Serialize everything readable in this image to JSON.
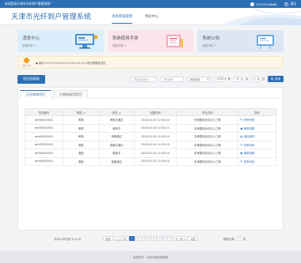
{
  "topbar": {
    "welcome": "欢迎登录天津市光纤到户管理系统！",
    "phone": "15122228888",
    "logout": "退出"
  },
  "header": {
    "title": "天津市光纤到户管理系统",
    "nav": [
      "项目审核管理",
      "帮助中心"
    ]
  },
  "cards": [
    {
      "title": "消息中心",
      "link": "查看详情 ➜"
    },
    {
      "title": "系统使用手册",
      "link": "查看详情 ➜"
    },
    {
      "title": "系统公告",
      "link": "查看详情 ➜"
    }
  ],
  "notice": {
    "label": "最新公告",
    "text": "● 编号1121231415431151421411212项目需要被选定"
  },
  "toolbar": {
    "add_button": "项目档案新",
    "project_name_placeholder": "项目名称查询",
    "project_no_placeholder": "项目编号",
    "status_select": "状态查询",
    "year": "2018",
    "year_label": "年",
    "month": "12",
    "month_label": "月",
    "day": "1",
    "day_label": "日",
    "search_button": "查询"
  },
  "tabs": [
    "正在审核项目",
    "已审核成功项目"
  ],
  "table": {
    "headers": [
      "项目编号",
      "类型",
      "状态",
      "创建时间",
      "项目名称",
      "操作"
    ],
    "rows": [
      {
        "id": "wm00000001",
        "type": "审核",
        "status": "审核未通过",
        "time": "2018.01.04 12:30:14",
        "name": "天津国际综合中心三期",
        "op": "先修代码",
        "op_icon": "edit-icon"
      },
      {
        "id": "wm00000001",
        "type": "审核",
        "status": "审核中",
        "time": "2018.01.04 12:30:14",
        "name": "天津国际综合中心三期",
        "op": "审核查看",
        "op_icon": "view-icon"
      },
      {
        "id": "wm00000001",
        "type": "审核",
        "status": "审核通过",
        "time": "2018.01.04 12:30:14",
        "name": "天津国际综合中心三期",
        "op": "添加资料",
        "op_icon": "doc-icon"
      },
      {
        "id": "wm00000001",
        "type": "退盘",
        "status": "退盘未通过",
        "time": "2018.01.04 12:30:14",
        "name": "天津国际综合中心三期",
        "op": "先修代码",
        "op_icon": "edit-icon"
      },
      {
        "id": "wm00000001",
        "type": "退盘",
        "status": "退盘中",
        "time": "2018.01.04 12:30:14",
        "name": "天津国际综合中心三期",
        "op": "审核查看",
        "op_icon": "view-icon"
      },
      {
        "id": "wm00000001",
        "type": "退盘",
        "status": "退盘通过",
        "time": "2018.01.04 12:30:14",
        "name": "天津国际综合中心三期",
        "op": "先修代码",
        "op_icon": "edit-icon"
      }
    ]
  },
  "pager": {
    "count": "共204 条记录 1/14 页",
    "first": "首页",
    "prev": "« 上一页",
    "pages": [
      "1",
      "2",
      "3",
      "4",
      "5",
      "6",
      "7"
    ],
    "next": "下一页 »",
    "last": "末页",
    "per_page_label": "跳转至第",
    "per_page_value": "1",
    "per_page_unit": "页"
  },
  "footer": {
    "copyright": "版权所有：天津市通信管理局"
  },
  "colors": {
    "primary": "#2c6fb5",
    "notice_bg": "#fdf6e6",
    "card1": "#dbeefb",
    "card2": "#fbe4ea",
    "card3": "#dde7f4"
  }
}
